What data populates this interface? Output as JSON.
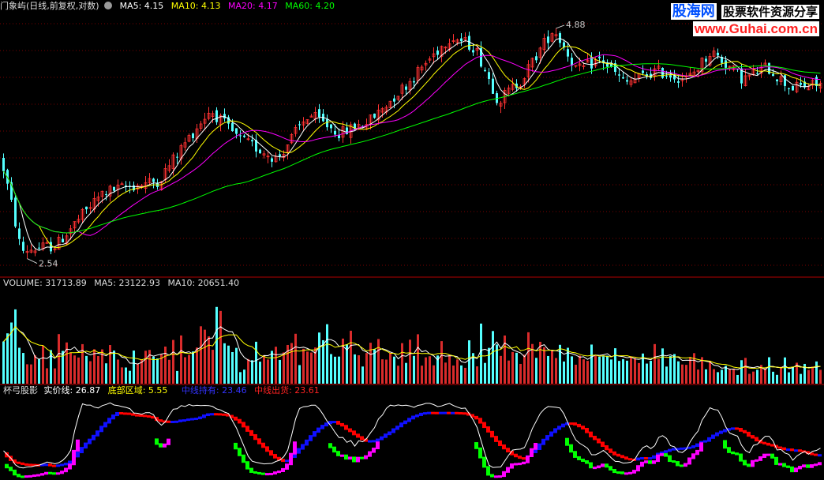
{
  "header": {
    "stock_label": "门象屿(日线,前复权,对数)",
    "ma": [
      {
        "label": "MA5: 4.15",
        "color": "#ffffff"
      },
      {
        "label": "MA10: 4.13",
        "color": "#ffff00"
      },
      {
        "label": "MA20: 4.17",
        "color": "#ff00ff"
      },
      {
        "label": "MA60: 4.20",
        "color": "#00ff00"
      }
    ]
  },
  "volume_legend": [
    {
      "label": "VOLUME: 31713.89",
      "color": "#dddddd"
    },
    {
      "label": "MA5: 23122.93",
      "color": "#dddddd"
    },
    {
      "label": "MA10: 20651.40",
      "color": "#dddddd"
    }
  ],
  "indicator_legend": [
    {
      "label": "杯弓股影",
      "color": "#dddddd"
    },
    {
      "label": "实价线: 26.87",
      "color": "#ffffff"
    },
    {
      "label": "底部区域: 5.55",
      "color": "#ffff00"
    },
    {
      "label": "中线持有: 23.46",
      "color": "#0000ff"
    },
    {
      "label": "中线出货: 23.61",
      "color": "#ff0000"
    }
  ],
  "logo": {
    "line1_a": "股海网",
    "line1_b": "股票软件资源分享",
    "line2": "www.Guhai.com.cn"
  },
  "chart_data": {
    "type": "candlestick",
    "price_high_label": "4.88",
    "price_low_label": "2.54",
    "price_range": [
      2.4,
      5.1
    ],
    "volume_range": [
      0,
      110000
    ],
    "indicator_range": [
      0,
      100
    ]
  }
}
